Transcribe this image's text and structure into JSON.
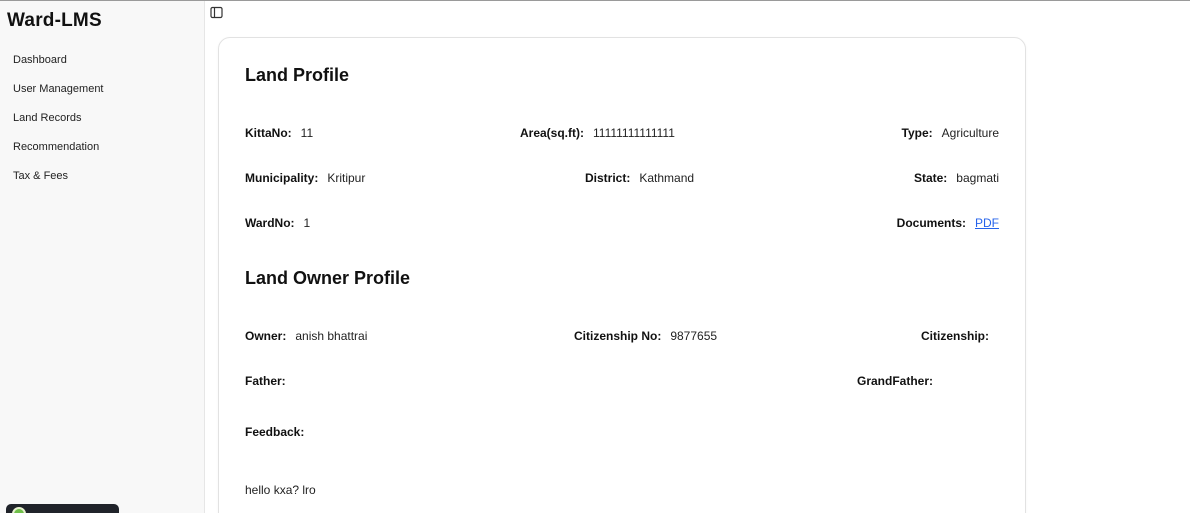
{
  "app": {
    "brand": "Ward-LMS"
  },
  "sidebar": {
    "items": [
      {
        "label": "Dashboard"
      },
      {
        "label": "User Management"
      },
      {
        "label": "Land Records"
      },
      {
        "label": "Recommendation"
      },
      {
        "label": "Tax & Fees"
      }
    ]
  },
  "icons": {
    "sidebar_toggle": "panel-left-icon"
  },
  "land_profile": {
    "title": "Land Profile",
    "kitta_label": "KittaNo:",
    "kitta_value": "11",
    "area_label": "Area(sq.ft):",
    "area_value": "11111111111111",
    "type_label": "Type:",
    "type_value": "Agriculture",
    "municipality_label": "Municipality:",
    "municipality_value": "Kritipur",
    "district_label": "District:",
    "district_value": "Kathmand",
    "state_label": "State:",
    "state_value": "bagmati",
    "ward_label": "WardNo:",
    "ward_value": "1",
    "documents_label": "Documents:",
    "documents_link": "PDF"
  },
  "owner_profile": {
    "title": "Land Owner Profile",
    "owner_label": "Owner:",
    "owner_value": "anish bhattrai",
    "citizenship_no_label": "Citizenship No:",
    "citizenship_no_value": "9877655",
    "citizenship_label": "Citizenship:",
    "citizenship_value": "",
    "father_label": "Father:",
    "father_value": "",
    "grandfather_label": "GrandFather:",
    "grandfather_value": "",
    "feedback_label": "Feedback:",
    "feedback_text": "hello kxa? lro"
  }
}
